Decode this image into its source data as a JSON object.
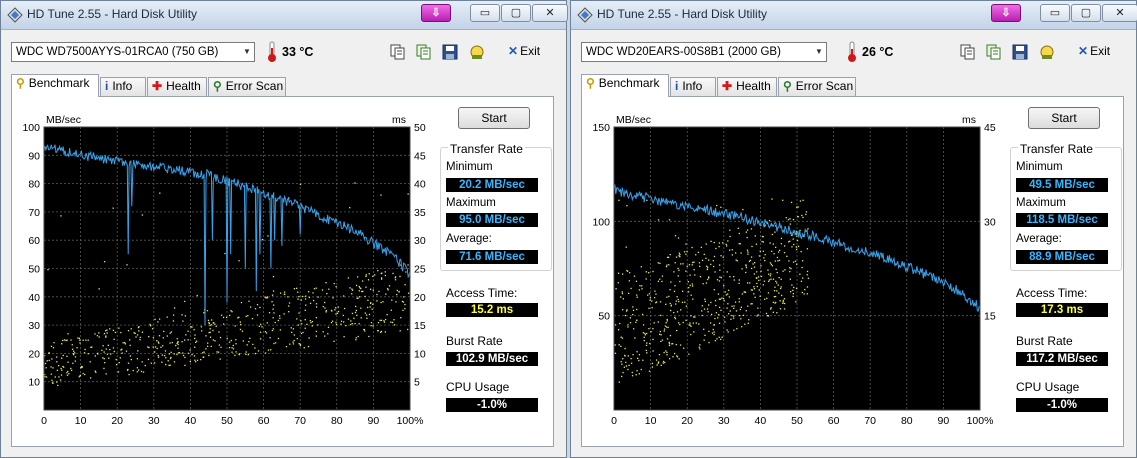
{
  "windows": [
    {
      "title": "HD Tune 2.55 - Hard Disk Utility",
      "drive": "WDC WD7500AYYS-01RCA0 (750 GB)",
      "temperature": "33 °C",
      "exit_label": "Exit",
      "tabs": [
        {
          "label": "Benchmark",
          "icon": "benchmark-icon"
        },
        {
          "label": "Info",
          "icon": "info-icon"
        },
        {
          "label": "Health",
          "icon": "health-icon"
        },
        {
          "label": "Error Scan",
          "icon": "error-scan-icon"
        }
      ],
      "start_label": "Start",
      "transfer_rate_label": "Transfer Rate",
      "minimum_label": "Minimum",
      "minimum": "20.2 MB/sec",
      "maximum_label": "Maximum",
      "maximum": "95.0 MB/sec",
      "average_label": "Average:",
      "average": "71.6 MB/sec",
      "access_time_label": "Access Time:",
      "access_time": "15.2 ms",
      "burst_rate_label": "Burst Rate",
      "burst_rate": "102.9 MB/sec",
      "cpu_usage_label": "CPU Usage",
      "cpu_usage": "-1.0%",
      "chart_data": {
        "type": "line",
        "ylabel": "MB/sec",
        "y2label": "ms",
        "ylim": [
          0,
          100
        ],
        "y2lim": [
          0,
          50
        ],
        "yticks": [
          10,
          20,
          30,
          40,
          50,
          60,
          70,
          80,
          90,
          100
        ],
        "y2ticks": [
          5,
          10,
          15,
          20,
          25,
          30,
          35,
          40,
          45,
          50
        ],
        "xticks": [
          "0",
          "10",
          "20",
          "30",
          "40",
          "50",
          "60",
          "70",
          "80",
          "90",
          "100%"
        ],
        "grid": true,
        "transfer_series": {
          "x": [
            0,
            5,
            10,
            15,
            20,
            25,
            30,
            35,
            40,
            45,
            50,
            55,
            60,
            65,
            70,
            75,
            80,
            85,
            90,
            95,
            100
          ],
          "y": [
            93,
            92,
            90,
            89,
            88,
            87,
            86,
            85,
            84,
            83,
            81,
            79,
            77,
            74,
            72,
            69,
            66,
            63,
            59,
            55,
            48
          ],
          "dips": [
            [
              23,
              55
            ],
            [
              24,
              72
            ],
            [
              44,
              30
            ],
            [
              46,
              60
            ],
            [
              50,
              38
            ],
            [
              51,
              55
            ],
            [
              55,
              50
            ],
            [
              58,
              42
            ],
            [
              59,
              55
            ],
            [
              62,
              50
            ],
            [
              63,
              60
            ],
            [
              65,
              58
            ],
            [
              70,
              62
            ]
          ]
        },
        "access_scatter": {
          "x_range": [
            0,
            100
          ],
          "band_start_ms": [
            4,
            12
          ],
          "band_end_ms": [
            14,
            26
          ],
          "outlier_ms_max": 42
        }
      }
    },
    {
      "title": "HD Tune 2.55 - Hard Disk Utility",
      "drive": "WDC WD20EARS-00S8B1 (2000 GB)",
      "temperature": "26 °C",
      "exit_label": "Exit",
      "tabs": [
        {
          "label": "Benchmark",
          "icon": "benchmark-icon"
        },
        {
          "label": "Info",
          "icon": "info-icon"
        },
        {
          "label": "Health",
          "icon": "health-icon"
        },
        {
          "label": "Error Scan",
          "icon": "error-scan-icon"
        }
      ],
      "start_label": "Start",
      "transfer_rate_label": "Transfer Rate",
      "minimum_label": "Minimum",
      "minimum": "49.5 MB/sec",
      "maximum_label": "Maximum",
      "maximum": "118.5 MB/sec",
      "average_label": "Average:",
      "average": "88.9 MB/sec",
      "access_time_label": "Access Time:",
      "access_time": "17.3 ms",
      "burst_rate_label": "Burst Rate",
      "burst_rate": "117.2 MB/sec",
      "cpu_usage_label": "CPU Usage",
      "cpu_usage": "-1.0%",
      "chart_data": {
        "type": "line",
        "ylabel": "MB/sec",
        "y2label": "ms",
        "ylim": [
          0,
          150
        ],
        "y2lim": [
          0,
          45
        ],
        "yticks": [
          50,
          100,
          150
        ],
        "y2ticks": [
          15,
          30,
          45
        ],
        "xticks": [
          "0",
          "10",
          "20",
          "30",
          "40",
          "50",
          "60",
          "70",
          "80",
          "90",
          "100%"
        ],
        "grid": true,
        "transfer_series": {
          "x": [
            0,
            5,
            10,
            15,
            20,
            25,
            30,
            35,
            40,
            45,
            50,
            55,
            60,
            65,
            70,
            75,
            80,
            85,
            90,
            95,
            100
          ],
          "y": [
            117,
            114,
            112,
            110,
            108,
            106,
            104,
            102,
            99,
            97,
            94,
            92,
            89,
            86,
            83,
            80,
            76,
            72,
            67,
            62,
            54
          ],
          "dips": []
        },
        "access_scatter": {
          "x_range": [
            0,
            53
          ],
          "band_start_ms": [
            3,
            22
          ],
          "band_end_ms": [
            18,
            32
          ],
          "outlier_ms_max": 34
        }
      }
    }
  ]
}
